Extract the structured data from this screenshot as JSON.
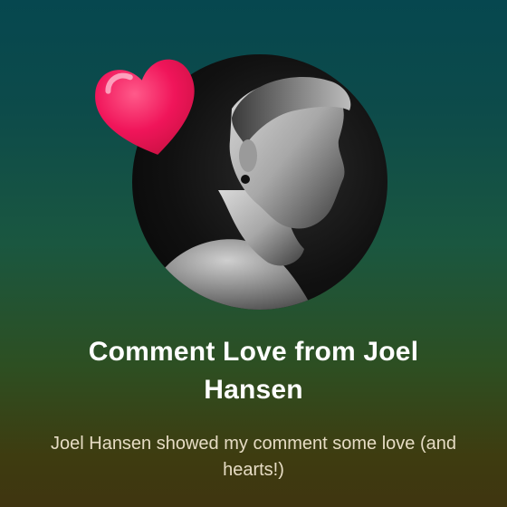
{
  "card": {
    "title": "Comment Love from Joel Hansen",
    "subtitle": "Joel Hansen showed my comment some love (and hearts!)"
  },
  "icons": {
    "heart": "heart-icon",
    "avatar": "profile-photo"
  },
  "colors": {
    "heart": "#f0155a",
    "title": "#ffffff",
    "subtitle": "#e6dcc4"
  }
}
